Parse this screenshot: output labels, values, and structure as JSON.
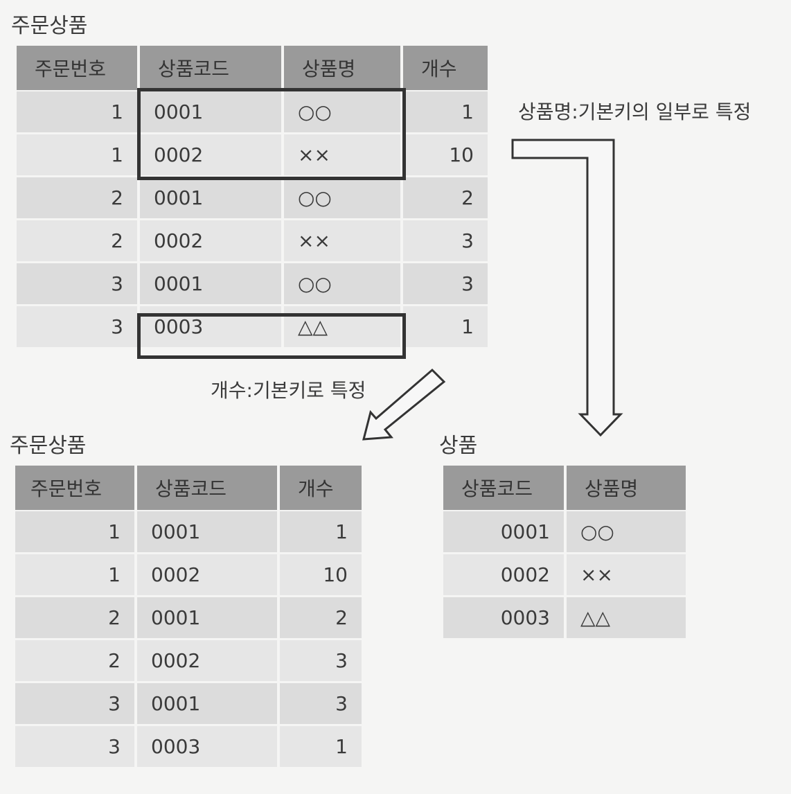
{
  "orders_before": {
    "caption": "주문상품",
    "headers": [
      "주문번호",
      "상품코드",
      "상품명",
      "개수"
    ],
    "rows": [
      [
        "1",
        "0001",
        "○○",
        "1"
      ],
      [
        "1",
        "0002",
        "××",
        "10"
      ],
      [
        "2",
        "0001",
        "○○",
        "2"
      ],
      [
        "2",
        "0002",
        "××",
        "3"
      ],
      [
        "3",
        "0001",
        "○○",
        "3"
      ],
      [
        "3",
        "0003",
        "△△",
        "1"
      ]
    ]
  },
  "notes": {
    "product_name": "상품명:기본키의 일부로 특정",
    "quantity": "개수:기본키로 특정"
  },
  "orders_after": {
    "caption": "주문상품",
    "headers": [
      "주문번호",
      "상품코드",
      "개수"
    ],
    "rows": [
      [
        "1",
        "0001",
        "1"
      ],
      [
        "1",
        "0002",
        "10"
      ],
      [
        "2",
        "0001",
        "2"
      ],
      [
        "2",
        "0002",
        "3"
      ],
      [
        "3",
        "0001",
        "3"
      ],
      [
        "3",
        "0003",
        "1"
      ]
    ]
  },
  "products": {
    "caption": "상품",
    "headers": [
      "상품코드",
      "상품명"
    ],
    "rows": [
      [
        "0001",
        "○○"
      ],
      [
        "0002",
        "××"
      ],
      [
        "0003",
        "△△"
      ]
    ]
  }
}
